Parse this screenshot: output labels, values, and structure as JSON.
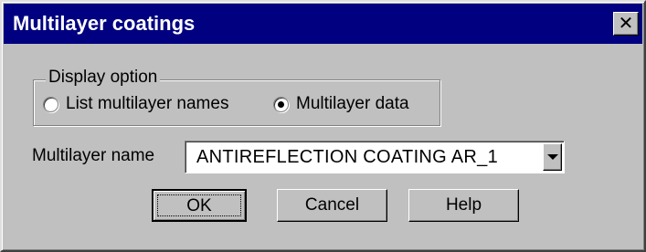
{
  "window": {
    "title": "Multilayer coatings",
    "close_label": "✕"
  },
  "display_option": {
    "legend": "Display option",
    "options": [
      {
        "label": "List multilayer names",
        "checked": false
      },
      {
        "label": "Multilayer data",
        "checked": true
      }
    ]
  },
  "multilayer": {
    "label": "Multilayer name",
    "value": "ANTIREFLECTION COATING AR_1"
  },
  "buttons": {
    "ok": "OK",
    "cancel": "Cancel",
    "help": "Help"
  },
  "colors": {
    "titlebar": "#000080",
    "face": "#c0c0c0"
  }
}
